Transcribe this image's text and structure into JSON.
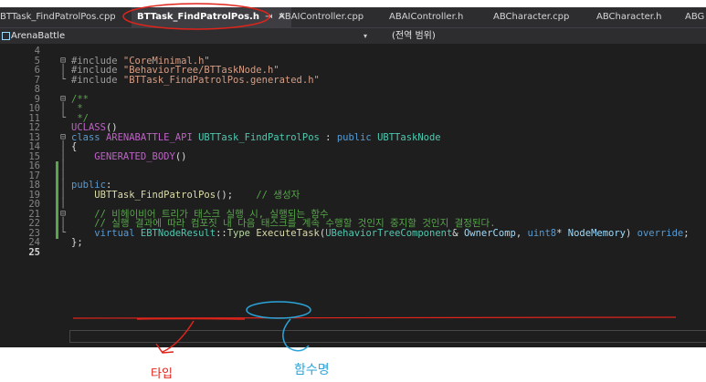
{
  "tabs": [
    {
      "label": "BTTask_FindPatrolPos.cpp",
      "active": false
    },
    {
      "label": "BTTask_FindPatrolPos.h",
      "active": true
    },
    {
      "label": "ABAIController.cpp",
      "active": false
    },
    {
      "label": "ABAIController.h",
      "active": false
    },
    {
      "label": "ABCharacter.cpp",
      "active": false
    },
    {
      "label": "ABCharacter.h",
      "active": false
    },
    {
      "label": "ABG",
      "active": false
    }
  ],
  "tab_pin_glyph": "⇥",
  "tab_close_glyph": "✕",
  "nav": {
    "project": "ArenaBattle",
    "dropdown_glyph": "▾",
    "scope": "(전역 범위)"
  },
  "fold_glyphs": {
    "open": "⊟",
    "guide": "│",
    "end": "└"
  },
  "code_lines": [
    {
      "n": "4"
    },
    {
      "n": "5",
      "parts": [
        {
          "t": "#include ",
          "c": "pp"
        },
        {
          "t": "\"CoreMinimal.h\"",
          "c": "str"
        }
      ]
    },
    {
      "n": "6",
      "parts": [
        {
          "t": "#include ",
          "c": "pp"
        },
        {
          "t": "\"BehaviorTree/BTTaskNode.h\"",
          "c": "str"
        }
      ]
    },
    {
      "n": "7",
      "parts": [
        {
          "t": "#include ",
          "c": "pp"
        },
        {
          "t": "\"BTTask_FindPatrolPos.generated.h\"",
          "c": "str"
        }
      ]
    },
    {
      "n": "8"
    },
    {
      "n": "9",
      "parts": [
        {
          "t": "/**",
          "c": "cmt"
        }
      ]
    },
    {
      "n": "10",
      "parts": [
        {
          "t": " *",
          "c": "cmt"
        }
      ]
    },
    {
      "n": "11",
      "parts": [
        {
          "t": " */",
          "c": "cmt"
        }
      ]
    },
    {
      "n": "12",
      "parts": [
        {
          "t": "UCLASS",
          "c": "mac"
        },
        {
          "t": "()",
          "c": "txt"
        }
      ]
    },
    {
      "n": "13",
      "parts": [
        {
          "t": "class ",
          "c": "kw"
        },
        {
          "t": "ARENABATTLE_API ",
          "c": "mac"
        },
        {
          "t": "UBTTask_FindPatrolPos",
          "c": "cls"
        },
        {
          "t": " : ",
          "c": "txt"
        },
        {
          "t": "public ",
          "c": "kw"
        },
        {
          "t": "UBTTaskNode",
          "c": "cls"
        }
      ]
    },
    {
      "n": "14",
      "parts": [
        {
          "t": "{",
          "c": "txt"
        }
      ]
    },
    {
      "n": "15",
      "parts": [
        {
          "t": "    ",
          "c": "txt"
        },
        {
          "t": "GENERATED_BODY",
          "c": "mac"
        },
        {
          "t": "()",
          "c": "txt"
        }
      ]
    },
    {
      "n": "16"
    },
    {
      "n": "17"
    },
    {
      "n": "18",
      "parts": [
        {
          "t": "public",
          "c": "kw"
        },
        {
          "t": ":",
          "c": "txt"
        }
      ]
    },
    {
      "n": "19",
      "parts": [
        {
          "t": "    ",
          "c": "txt"
        },
        {
          "t": "UBTTask_FindPatrolPos",
          "c": "fn"
        },
        {
          "t": "();    ",
          "c": "txt"
        },
        {
          "t": "// 생성자",
          "c": "cmt"
        }
      ]
    },
    {
      "n": "20"
    },
    {
      "n": "21",
      "parts": [
        {
          "t": "    ",
          "c": "txt"
        },
        {
          "t": "// 비헤이비어 트리가 태스크 실행 시, 실행되는 함수",
          "c": "cmt"
        }
      ]
    },
    {
      "n": "22",
      "parts": [
        {
          "t": "    ",
          "c": "txt"
        },
        {
          "t": "// 실행 결과에 따라 컴포짓 내 다음 태스크를 계속 수행할 것인지 중지할 것인지 결정된다.",
          "c": "cmt"
        }
      ]
    },
    {
      "n": "23",
      "parts": [
        {
          "t": "    ",
          "c": "txt"
        },
        {
          "t": "virtual ",
          "c": "kw"
        },
        {
          "t": "EBTNodeResult",
          "c": "cls"
        },
        {
          "t": "::",
          "c": "txt"
        },
        {
          "t": "Type",
          "c": "enum"
        },
        {
          "t": " ",
          "c": "txt"
        },
        {
          "t": "ExecuteTask",
          "c": "fn"
        },
        {
          "t": "(",
          "c": "txt"
        },
        {
          "t": "UBehaviorTreeComponent",
          "c": "cls"
        },
        {
          "t": "& ",
          "c": "txt"
        },
        {
          "t": "OwnerComp",
          "c": "par"
        },
        {
          "t": ", ",
          "c": "txt"
        },
        {
          "t": "uint8",
          "c": "kw"
        },
        {
          "t": "* ",
          "c": "txt"
        },
        {
          "t": "NodeMemory",
          "c": "par"
        },
        {
          "t": ") ",
          "c": "txt"
        },
        {
          "t": "override",
          "c": "kw"
        },
        {
          "t": ";",
          "c": "txt"
        }
      ]
    },
    {
      "n": "24",
      "parts": [
        {
          "t": "};",
          "c": "txt"
        }
      ]
    },
    {
      "n": "25"
    }
  ],
  "annotations": {
    "type_label": "타입",
    "function_name_label": "함수명",
    "color": "#e0241b",
    "highlight_color": "#2aa4d9"
  }
}
